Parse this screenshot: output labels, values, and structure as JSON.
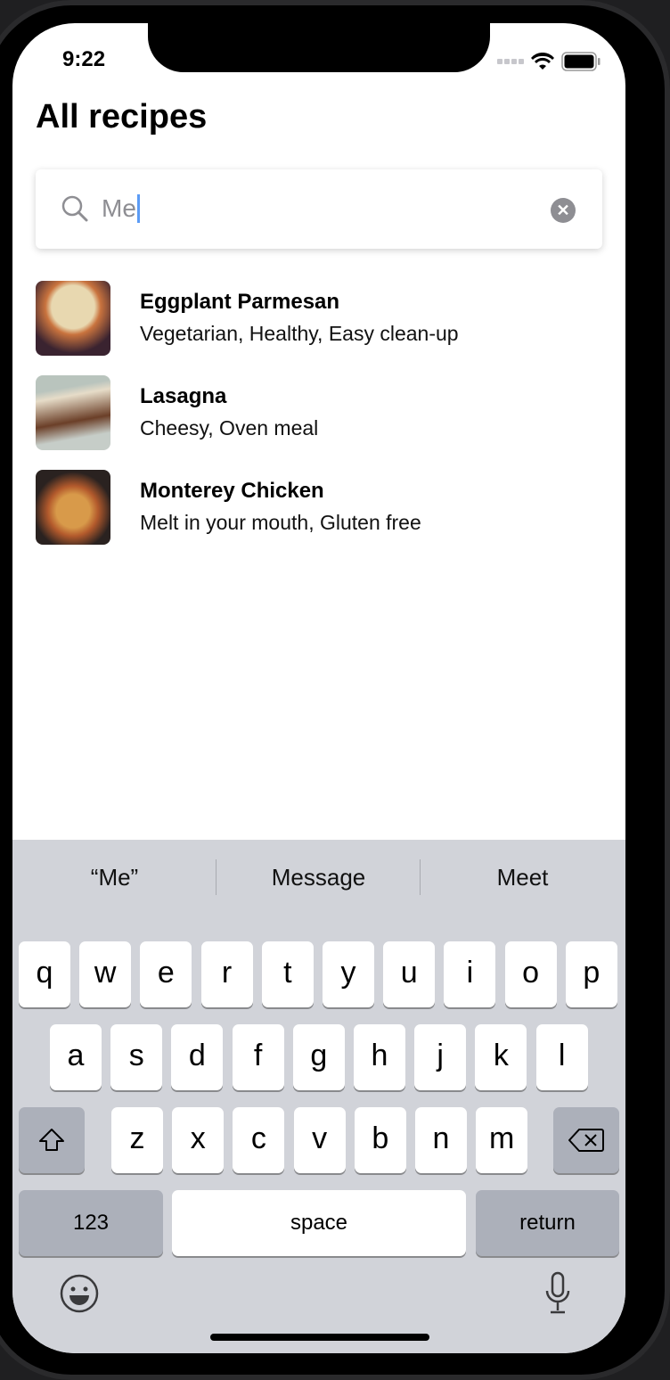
{
  "status": {
    "time": "9:22",
    "icons": [
      "signal-icon",
      "wifi-icon",
      "battery-icon"
    ]
  },
  "title": "All recipes",
  "search": {
    "value": "Me",
    "icon": "search-icon",
    "clear_icon": "clear-icon"
  },
  "recipes": [
    {
      "name": "Eggplant Parmesan",
      "tags": "Vegetarian, Healthy, Easy clean-up"
    },
    {
      "name": "Lasagna",
      "tags": "Cheesy, Oven meal"
    },
    {
      "name": "Monterey Chicken",
      "tags": "Melt in your mouth, Gluten free"
    }
  ],
  "keyboard": {
    "suggestions": [
      "“Me”",
      "Message",
      "Meet"
    ],
    "row1": [
      "q",
      "w",
      "e",
      "r",
      "t",
      "y",
      "u",
      "i",
      "o",
      "p"
    ],
    "row2": [
      "a",
      "s",
      "d",
      "f",
      "g",
      "h",
      "j",
      "k",
      "l"
    ],
    "row3": [
      "z",
      "x",
      "c",
      "v",
      "b",
      "n",
      "m"
    ],
    "numbers": "123",
    "space": "space",
    "return": "return"
  }
}
